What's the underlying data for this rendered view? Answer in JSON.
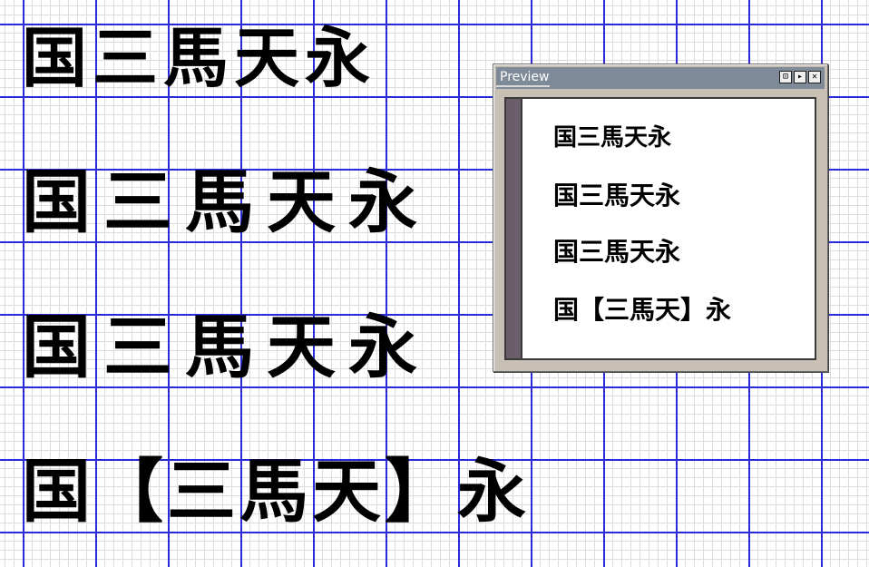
{
  "canvas": {
    "rows": [
      "国三馬天永",
      "国三馬天永",
      "国三馬天永",
      "国【三馬天】永"
    ]
  },
  "preview": {
    "title": "Preview",
    "buttons": [
      "⊡",
      "▸",
      "✕"
    ],
    "lines": [
      "国三馬天永",
      "国三馬天永",
      "国三馬天永",
      "国【三馬天】永"
    ]
  }
}
